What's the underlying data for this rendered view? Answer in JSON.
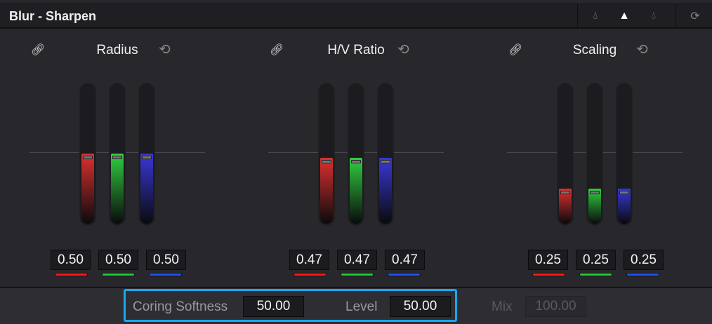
{
  "title": "Blur - Sharpen",
  "header_icons": [
    "blur-drop-icon",
    "sharpen-triangle-icon",
    "mist-drop-icon",
    "reset-all-icon"
  ],
  "groups": [
    {
      "label": "Radius",
      "values": [
        "0.50",
        "0.50",
        "0.50"
      ],
      "levels": [
        0.5,
        0.5,
        0.5
      ]
    },
    {
      "label": "H/V Ratio",
      "values": [
        "0.47",
        "0.47",
        "0.47"
      ],
      "levels": [
        0.47,
        0.47,
        0.47
      ]
    },
    {
      "label": "Scaling",
      "values": [
        "0.25",
        "0.25",
        "0.25"
      ],
      "levels": [
        0.25,
        0.25,
        0.25
      ]
    }
  ],
  "channel_colors": [
    "#e03030",
    "#30d040",
    "#3838d8"
  ],
  "underline_colors": [
    "#ff1a1a",
    "#22cc33",
    "#2255ee"
  ],
  "bottom": {
    "coring_label": "Coring Softness",
    "coring_value": "50.00",
    "level_label": "Level",
    "level_value": "50.00",
    "mix_label": "Mix",
    "mix_value": "100.00"
  },
  "highlight_color": "#19a8f0"
}
